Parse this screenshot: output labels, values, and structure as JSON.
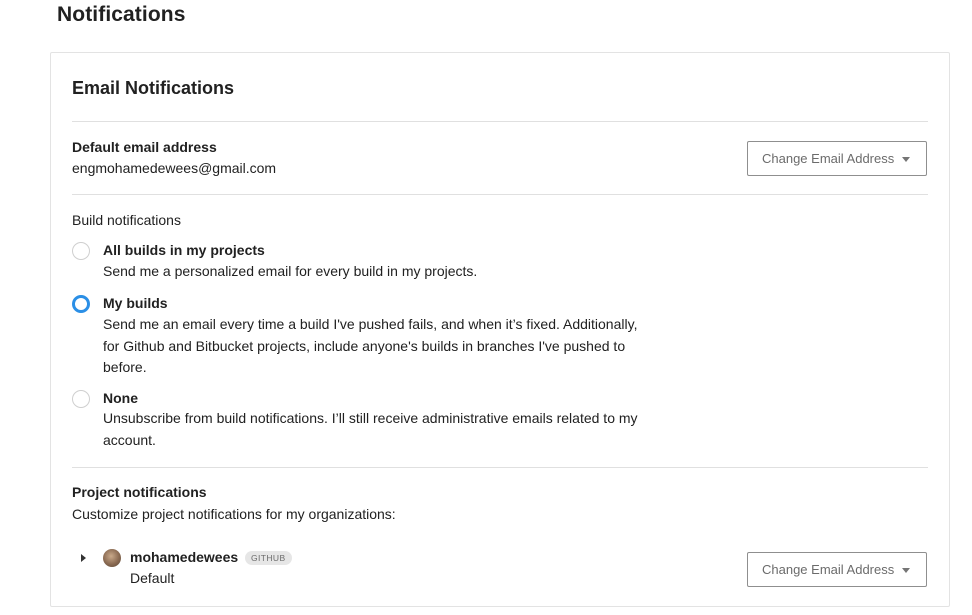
{
  "page": {
    "title": "Notifications"
  },
  "email_section": {
    "title": "Email Notifications",
    "default_email": {
      "label": "Default email address",
      "value": "engmohamedewees@gmail.com",
      "change_button": "Change Email Address"
    },
    "build_notifications": {
      "label": "Build notifications",
      "options": [
        {
          "title": "All builds in my projects",
          "description": "Send me a personalized email for every build in my projects.",
          "selected": false
        },
        {
          "title": "My builds",
          "description": "Send me an email every time a build I've pushed fails, and when it’s fixed. Additionally, for Github and Bitbucket projects, include anyone's builds in branches I've pushed to before.",
          "selected": true
        },
        {
          "title": "None",
          "description": "Unsubscribe from build notifications. I’ll still receive administrative emails related to my account.",
          "selected": false
        }
      ]
    },
    "project_notifications": {
      "label": "Project notifications",
      "description": "Customize project notifications for my organizations:",
      "organizations": [
        {
          "name": "mohamedewees",
          "vcs": "GITHUB",
          "setting": "Default",
          "change_button": "Change Email Address"
        }
      ]
    }
  },
  "colors": {
    "accent": "#2b8fe6",
    "border": "#e3e3e3",
    "text": "#212121",
    "muted": "#6b6b6b"
  },
  "icons": {
    "dropdown": "chevron-down-icon",
    "expand": "chevron-right-icon",
    "avatar": "user-avatar"
  }
}
